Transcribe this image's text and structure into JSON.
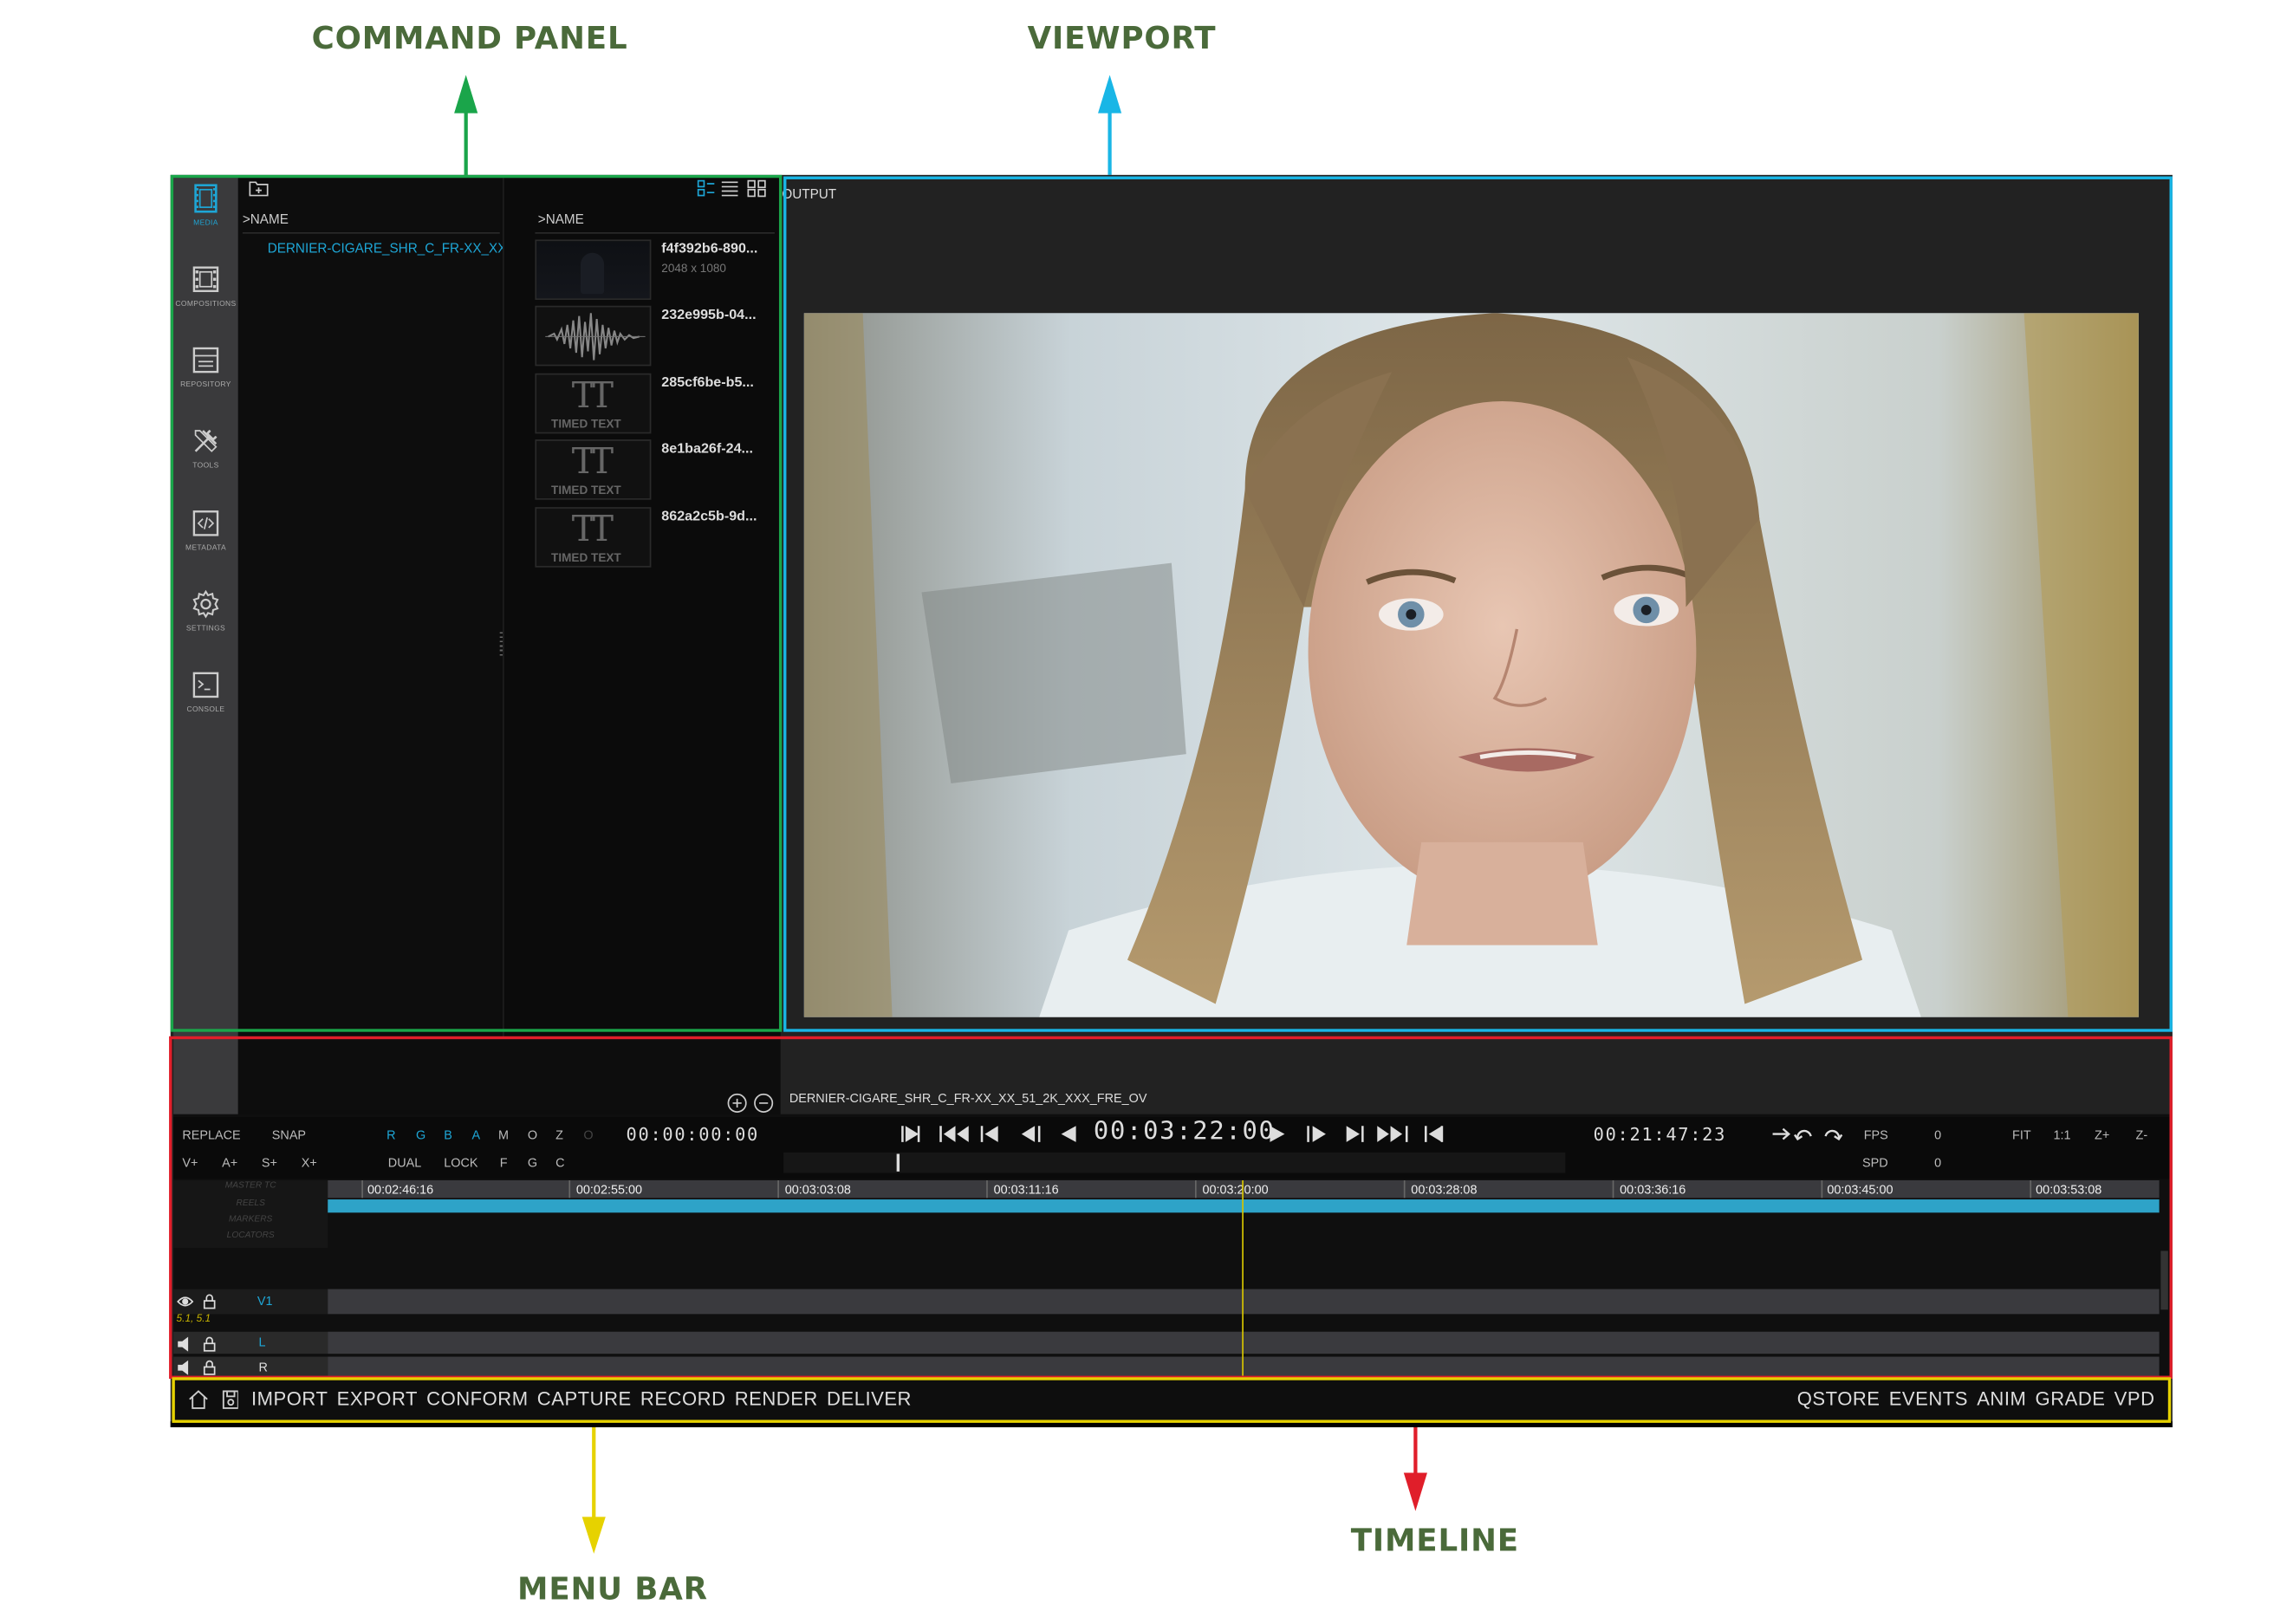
{
  "callouts": {
    "command_panel": "COMMAND PANEL",
    "viewport": "VIEWPORT",
    "menu_bar": "MENU BAR",
    "timeline": "TIMELINE"
  },
  "sidebar": {
    "items": [
      {
        "label": "MEDIA",
        "icon": "film-strip-icon"
      },
      {
        "label": "COMPOSITIONS",
        "icon": "composition-icon"
      },
      {
        "label": "REPOSITORY",
        "icon": "repository-icon"
      },
      {
        "label": "TOOLS",
        "icon": "tools-icon"
      },
      {
        "label": "METADATA",
        "icon": "code-icon"
      },
      {
        "label": "SETTINGS",
        "icon": "gear-icon"
      },
      {
        "label": "CONSOLE",
        "icon": "terminal-icon"
      }
    ]
  },
  "media": {
    "left_header": ">NAME",
    "right_header": ">NAME",
    "folder_item": "DERNIER-CIGARE_SHR_C_FR-XX_XX...",
    "assets": [
      {
        "name": "f4f392b6-890...",
        "sub": "2048 x 1080",
        "type": "video"
      },
      {
        "name": "232e995b-04...",
        "sub": "",
        "type": "audio"
      },
      {
        "name": "285cf6be-b5...",
        "sub": "",
        "type": "timed-text"
      },
      {
        "name": "8e1ba26f-24...",
        "sub": "",
        "type": "timed-text"
      },
      {
        "name": "862a2c5b-9d...",
        "sub": "",
        "type": "timed-text"
      }
    ],
    "timed_text_label": "TIMED TEXT"
  },
  "viewport": {
    "label": "OUTPUT"
  },
  "timeline": {
    "comp_name": "DERNIER-CIGARE_SHR_C_FR-XX_XX_51_2K_XXX_FRE_OV",
    "row1_buttons": [
      "REPLACE",
      "SNAP"
    ],
    "row2_buttons": [
      "V+",
      "A+",
      "S+",
      "X+"
    ],
    "channel_buttons": [
      "R",
      "G",
      "B",
      "A",
      "M",
      "O",
      "Z",
      "O"
    ],
    "mode_buttons": [
      "DUAL",
      "LOCK",
      "F",
      "G",
      "C"
    ],
    "tc_in": "00:00:00:00",
    "tc_current": "00:03:22:00",
    "tc_duration": "00:21:47:23",
    "fps_label": "FPS",
    "fps_value": "0",
    "spd_label": "SPD",
    "spd_value": "0",
    "zoom_buttons": [
      "FIT",
      "1:1",
      "Z+",
      "Z-"
    ],
    "ruler_labels": [
      "00:02:46:16",
      "00:02:55:00",
      "00:03:03:08",
      "00:03:11:16",
      "00:03:20:00",
      "00:03:28:08",
      "00:03:36:16",
      "00:03:45:00",
      "00:03:53:08"
    ],
    "ruler_rows": [
      "MASTER TC",
      "REELS",
      "MARKERS",
      "LOCATORS"
    ],
    "tracks": [
      {
        "name": "V1",
        "info": "5.1, 5.1"
      },
      {
        "name": "L"
      },
      {
        "name": "R"
      }
    ]
  },
  "menubar": {
    "left": [
      "IMPORT",
      "EXPORT",
      "CONFORM",
      "CAPTURE",
      "RECORD",
      "RENDER",
      "DELIVER"
    ],
    "right": [
      "QSTORE",
      "EVENTS",
      "ANIM",
      "GRADE",
      "VPD"
    ]
  },
  "colors": {
    "accent": "#1ea6d6",
    "command_panel_frame": "#1aa54a",
    "viewport_frame": "#19b6e6",
    "timeline_frame": "#e01e2a",
    "menubar_frame": "#e6d200"
  }
}
